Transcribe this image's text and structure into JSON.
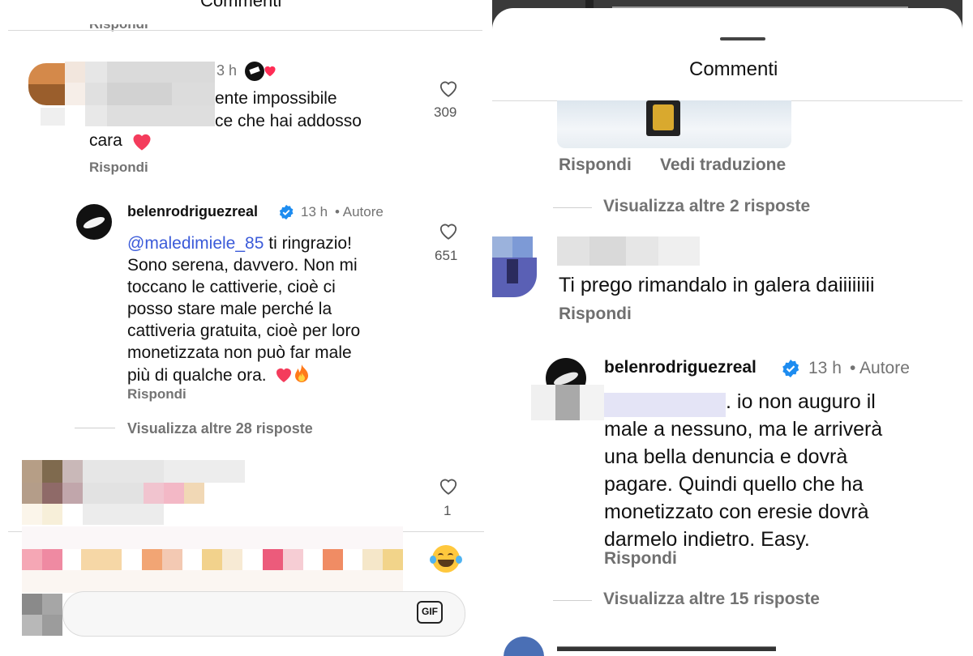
{
  "left": {
    "header_title": "Commenti",
    "top_reply": "Rispondi",
    "comment1": {
      "time": "3 h",
      "line1": "ente impossibile",
      "line2": "ce che hai addosso",
      "line3": "cara",
      "reply": "Rispondi",
      "likes": "309"
    },
    "reply1": {
      "username": "belenrodriguezreal",
      "time": "13 h",
      "author_tag": "• Autore",
      "mention": "@maledimiele_85",
      "lines": [
        " ti ringrazio!",
        "Sono serena, davvero. Non mi",
        "toccano le cattiverie, cioè ci",
        "posso stare male perché la",
        "cattiveria gratuita, cioè per loro",
        "monetizzata non può far male",
        "più di qualche ora."
      ],
      "reply": "Rispondi",
      "likes": "651"
    },
    "view_more": "Visualizza altre 28 risposte",
    "comment3": {
      "likes": "1"
    },
    "composer": {
      "gif_label": "GIF"
    }
  },
  "right": {
    "header_title": "Commenti",
    "reply_label": "Rispondi",
    "translate_label": "Vedi traduzione",
    "view_more_1": "Visualizza altre 2 risposte",
    "comment": {
      "text": "Ti prego rimandalo in galera daiiiiiiii",
      "reply": "Rispondi"
    },
    "author_reply": {
      "username": "belenrodriguezreal",
      "time": "13 h",
      "author_tag": "• Autore",
      "lines": [
        ". io non auguro il",
        "male a nessuno, ma le arriverà",
        "una bella denuncia e dovrà",
        "pagare. Quindi quello che ha",
        "monetizzato con eresie dovrà",
        "darmelo indietro. Easy."
      ],
      "reply": "Rispondi"
    },
    "view_more_2": "Visualizza altre 15 risposte"
  },
  "colors": {
    "accent_link": "#3b5bd9",
    "verified": "#1d8cf0",
    "heart_red": "#ff2d55"
  }
}
